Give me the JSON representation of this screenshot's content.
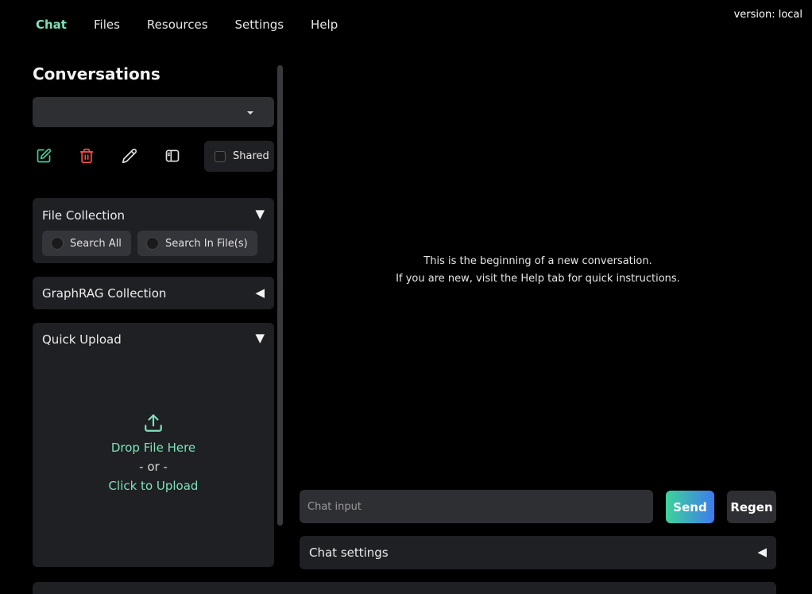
{
  "version": "version: local",
  "nav": {
    "tabs": [
      {
        "label": "Chat",
        "active": true
      },
      {
        "label": "Files",
        "active": false
      },
      {
        "label": "Resources",
        "active": false
      },
      {
        "label": "Settings",
        "active": false
      },
      {
        "label": "Help",
        "active": false
      }
    ]
  },
  "sidebar": {
    "title": "Conversations",
    "conversation_select": {
      "value": ""
    },
    "actions": [
      {
        "icon": "new-conversation-icon",
        "color": "#3ed39a"
      },
      {
        "icon": "trash-icon",
        "color": "#ff4d4d"
      },
      {
        "icon": "pencil-icon",
        "color": "#e0e0e0"
      },
      {
        "icon": "sidebar-toggle-icon",
        "color": "#e0e0e0"
      }
    ],
    "shared_label": "Shared",
    "file_collection": {
      "title": "File Collection",
      "toggle": "▼",
      "options": [
        "Search All",
        "Search In File(s)"
      ]
    },
    "graphrag_collection": {
      "title": "GraphRAG Collection",
      "toggle": "◀"
    },
    "quick_upload": {
      "title": "Quick Upload",
      "toggle": "▼",
      "drop_text": "Drop File Here",
      "or_text": "- or -",
      "click_text": "Click to Upload"
    }
  },
  "main": {
    "empty_line1": "This is the beginning of a new conversation.",
    "empty_line2": "If you are new, visit the Help tab for quick instructions.",
    "chat_input_placeholder": "Chat input",
    "send_label": "Send",
    "regen_label": "Regen",
    "chat_settings": {
      "title": "Chat settings",
      "toggle": "◀"
    }
  },
  "colors": {
    "accent": "#7ee2b8",
    "send_gradient_start": "#3ed39a",
    "send_gradient_end": "#3e7bf0",
    "panel_bg": "#1f2024"
  }
}
